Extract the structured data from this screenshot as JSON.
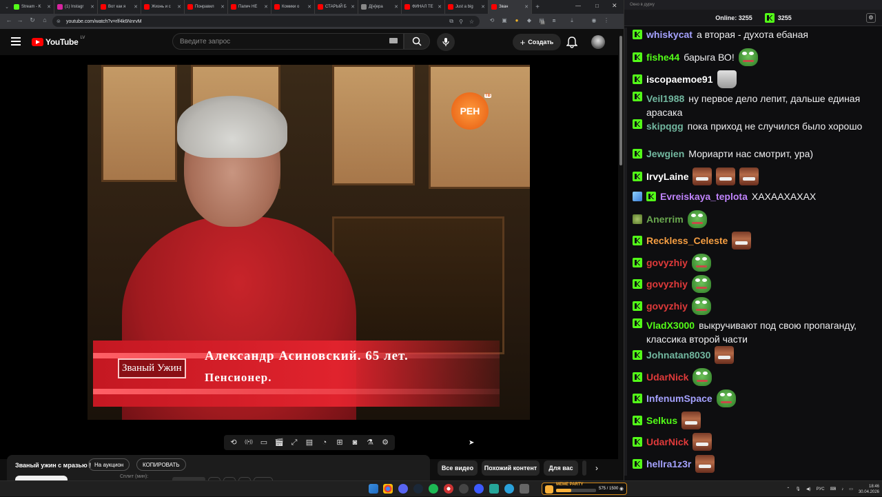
{
  "browser": {
    "tabs": [
      {
        "label": "Stream - K",
        "color": "#53fc18"
      },
      {
        "label": "(1) Instagr",
        "color": "#d6249f"
      },
      {
        "label": "Вот как я",
        "color": "#ff0000"
      },
      {
        "label": "Жизнь и с",
        "color": "#ff0000"
      },
      {
        "label": "Понравил",
        "color": "#ff0000"
      },
      {
        "label": "Папич НЕ",
        "color": "#ff0000"
      },
      {
        "label": "Комики о",
        "color": "#ff0000"
      },
      {
        "label": "СТАРЫЙ Б",
        "color": "#ff0000"
      },
      {
        "label": "Д[н]ера",
        "color": "#888888"
      },
      {
        "label": "ФИНАЛ ТЕ",
        "color": "#ff0000"
      },
      {
        "label": "Just a big",
        "color": "#ff0000"
      },
      {
        "label": "Зван",
        "color": "#ff0000"
      }
    ],
    "url": "youtube.com/watch?v=rlf4k6NnrvM",
    "ext_badge": "11"
  },
  "youtube": {
    "logo_text": "YouTube",
    "country_code": "LV",
    "search_placeholder": "Введите запрос",
    "create_label": "Создать"
  },
  "video_frame": {
    "channel_logo": "РЕН",
    "channel_logo_sub": "ТВ",
    "show_tag": "Званый Ужин",
    "caption_name": "Александр Асиновский. 65 лет.",
    "caption_job": "Пенсионер."
  },
  "video_tools": [
    "repeat-icon",
    "broadcast-icon",
    "screen-icon",
    "clapper-icon",
    "resize-icon",
    "subtitles-icon",
    "speed-icon",
    "add-clip-icon",
    "camera-icon",
    "flask-icon",
    "settings-icon"
  ],
  "video_meta": {
    "title": "Званый ужин с мразью !",
    "btn_auction": "На аукцион",
    "btn_copy": "КОПИРОВАТЬ",
    "split_label": "Сплит (мин):"
  },
  "chips": [
    {
      "label": "Все видео",
      "selected": true
    },
    {
      "label": "Похожий контент",
      "selected": false
    },
    {
      "label": "Для вас",
      "selected": false
    }
  ],
  "chat": {
    "window_title": "Окно в дурку",
    "online_label": "Online:",
    "online_count": "3255",
    "kick_count": "3255",
    "messages": [
      {
        "user": "whiskycat",
        "color": "#a5a2ff",
        "text": "а вторая - духота ебаная",
        "emotes": []
      },
      {
        "user": "fishe44",
        "color": "#53fc18",
        "text": "барыга ВО!",
        "emotes": [
          "pepe"
        ]
      },
      {
        "user": "iscopaemoe91",
        "color": "#ffffff",
        "text": "",
        "emotes": [
          "can"
        ]
      },
      {
        "user": "Veil1988",
        "color": "#72b8a0",
        "text": "ну первое дело лепит, дальше единая арасака",
        "emotes": []
      },
      {
        "user": "skipqgg",
        "color": "#72b8a0",
        "text": "пока приход не случился было хорошо",
        "emotes": []
      },
      {
        "user": "Jewgien",
        "color": "#72b8a0",
        "text": "Мориарти нас смотрит, ура)",
        "emotes": []
      },
      {
        "user": "IrvyLaine",
        "color": "#ffffff",
        "text": "",
        "emotes": [
          "face",
          "face",
          "face"
        ]
      },
      {
        "user": "Evreiskaya_teplota",
        "color": "#c084fc",
        "text": "ХАХААХАХАХ",
        "emotes": []
      },
      {
        "user": "Anerrim",
        "color": "#6aa84f",
        "text": "",
        "emotes": [
          "pepe"
        ]
      },
      {
        "user": "Reckless_Celeste",
        "color": "#f59e42",
        "text": "",
        "emotes": [
          "face"
        ]
      },
      {
        "user": "govyzhiy",
        "color": "#e03a3a",
        "text": "",
        "emotes": [
          "pepe"
        ]
      },
      {
        "user": "govyzhiy",
        "color": "#e03a3a",
        "text": "",
        "emotes": [
          "pepe"
        ]
      },
      {
        "user": "govyzhiy",
        "color": "#e03a3a",
        "text": "",
        "emotes": [
          "pepe"
        ]
      },
      {
        "user": "VladX3000",
        "color": "#53fc18",
        "text": "выкручивают под свою пропаганду, классика второй части",
        "emotes": []
      },
      {
        "user": "Johnatan8030",
        "color": "#72b8a0",
        "text": "",
        "emotes": [
          "face"
        ]
      },
      {
        "user": "UdarNick",
        "color": "#e03a3a",
        "text": "",
        "emotes": [
          "pepe"
        ]
      },
      {
        "user": "InfenumSpace",
        "color": "#a5a2ff",
        "text": "",
        "emotes": [
          "pepe"
        ]
      },
      {
        "user": "Selkus",
        "color": "#53fc18",
        "text": "",
        "emotes": [
          "face"
        ]
      },
      {
        "user": "UdarNick",
        "color": "#e03a3a",
        "text": "",
        "emotes": [
          "face"
        ]
      },
      {
        "user": "hellra1z3r",
        "color": "#a5a2ff",
        "text": "",
        "emotes": [
          "face"
        ]
      }
    ]
  },
  "taskbar": {
    "meme_party_label": "MEME PARTY",
    "meme_party_count": "575 / 1500",
    "meme_party_progress": 0.38,
    "lang": "РУС",
    "time": "18:46",
    "date": "30.04.2026"
  }
}
